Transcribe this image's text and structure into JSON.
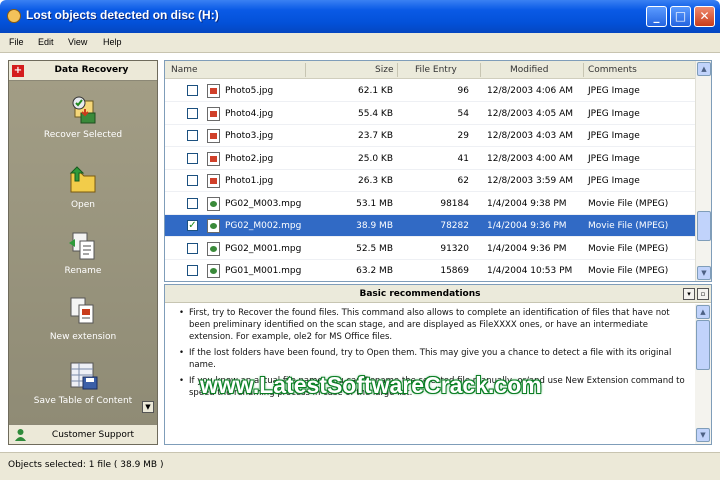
{
  "window": {
    "title": "Lost objects detected on disc (H:)",
    "minimize_glyph": "_",
    "maximize_glyph": "□",
    "close_glyph": "✕"
  },
  "menu": [
    "File",
    "Edit",
    "View",
    "Help"
  ],
  "sidebar": {
    "header": "Data Recovery",
    "header_icon": "+",
    "tools": [
      {
        "label": "Recover Selected",
        "icon": "recover-icon"
      },
      {
        "label": "Open",
        "icon": "open-folder-icon"
      },
      {
        "label": "Rename",
        "icon": "rename-icon"
      },
      {
        "label": "New extension",
        "icon": "new-extension-icon"
      },
      {
        "label": "Save Table of Content",
        "icon": "save-table-icon"
      }
    ],
    "footer": "Customer Support"
  },
  "file_list": {
    "columns": [
      "Name",
      "Size",
      "File Entry",
      "Modified",
      "Comments"
    ],
    "rows": [
      {
        "name": "Photo5.jpg",
        "size": "62.1 KB",
        "entry": "96",
        "modified": "12/8/2003 4:06 AM",
        "comments": "JPEG Image",
        "checked": false,
        "selected": false,
        "type": "jpg"
      },
      {
        "name": "Photo4.jpg",
        "size": "55.4 KB",
        "entry": "54",
        "modified": "12/8/2003 4:05 AM",
        "comments": "JPEG Image",
        "checked": false,
        "selected": false,
        "type": "jpg"
      },
      {
        "name": "Photo3.jpg",
        "size": "23.7 KB",
        "entry": "29",
        "modified": "12/8/2003 4:03 AM",
        "comments": "JPEG Image",
        "checked": false,
        "selected": false,
        "type": "jpg"
      },
      {
        "name": "Photo2.jpg",
        "size": "25.0 KB",
        "entry": "41",
        "modified": "12/8/2003 4:00 AM",
        "comments": "JPEG Image",
        "checked": false,
        "selected": false,
        "type": "jpg"
      },
      {
        "name": "Photo1.jpg",
        "size": "26.3 KB",
        "entry": "62",
        "modified": "12/8/2003 3:59 AM",
        "comments": "JPEG Image",
        "checked": false,
        "selected": false,
        "type": "jpg"
      },
      {
        "name": "PG02_M003.mpg",
        "size": "53.1 MB",
        "entry": "98184",
        "modified": "1/4/2004 9:38 PM",
        "comments": "Movie File (MPEG)",
        "checked": false,
        "selected": false,
        "type": "mpg"
      },
      {
        "name": "PG02_M002.mpg",
        "size": "38.9 MB",
        "entry": "78282",
        "modified": "1/4/2004 9:36 PM",
        "comments": "Movie File (MPEG)",
        "checked": true,
        "selected": true,
        "type": "mpg"
      },
      {
        "name": "PG02_M001.mpg",
        "size": "52.5 MB",
        "entry": "91320",
        "modified": "1/4/2004 9:36 PM",
        "comments": "Movie File (MPEG)",
        "checked": false,
        "selected": false,
        "type": "mpg"
      },
      {
        "name": "PG01_M001.mpg",
        "size": "63.2 MB",
        "entry": "15869",
        "modified": "1/4/2004 10:53 PM",
        "comments": "Movie File (MPEG)",
        "checked": false,
        "selected": false,
        "type": "mpg"
      }
    ],
    "scroll_up": "▲",
    "scroll_down": "▼"
  },
  "recommendations": {
    "title": "Basic recommendations",
    "paragraphs": [
      "First, try to Recover the found files. This command also allows to complete an identification of files that have not been preliminary identified on the scan stage, and are displayed as FileXXXX ones, or have an intermediate extension. For example, ole2 for MS Office files.",
      "If the lost folders have been found, try to Open them. This may give you a chance to detect a file with its original name.",
      "If you know an actual file name, you can Rename the selected file manually, or/and use New Extension command to speed the renaming process in case of the large list."
    ],
    "collapse_glyph": "▾",
    "close_glyph": "▫"
  },
  "watermark": "www.LatestSoftwareCrack.com",
  "status": "Objects selected: 1 file ( 38.9 MB )",
  "colors": {
    "titlebar": "#0351d8",
    "sidebar": "#9a9580",
    "selection": "#316ac5"
  }
}
